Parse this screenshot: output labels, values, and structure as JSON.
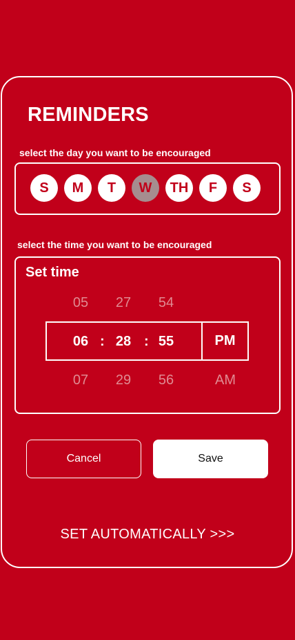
{
  "header": {
    "title": "REMINDERS"
  },
  "days": {
    "label": "select the day you want to be encouraged",
    "items": [
      {
        "label": "S",
        "selected": false
      },
      {
        "label": "M",
        "selected": false
      },
      {
        "label": "T",
        "selected": false
      },
      {
        "label": "W",
        "selected": true
      },
      {
        "label": "TH",
        "selected": false
      },
      {
        "label": "F",
        "selected": false
      },
      {
        "label": "S",
        "selected": false
      }
    ]
  },
  "time": {
    "label": "select the time you want to be encouraged",
    "title": "Set time",
    "above": {
      "hour": "05",
      "minute": "27",
      "second": "54"
    },
    "selected": {
      "hour": "06",
      "minute": "28",
      "second": "55",
      "period": "PM",
      "separator": ":"
    },
    "below": {
      "hour": "07",
      "minute": "29",
      "second": "56",
      "period": "AM"
    }
  },
  "actions": {
    "cancel_label": "Cancel",
    "save_label": "Save",
    "auto_label": "SET AUTOMATICALLY >>>"
  },
  "colors": {
    "background": "#c1001a",
    "surface": "#ffffff",
    "selected_day": "#a68d8f",
    "faded_text": "#e08a92"
  }
}
